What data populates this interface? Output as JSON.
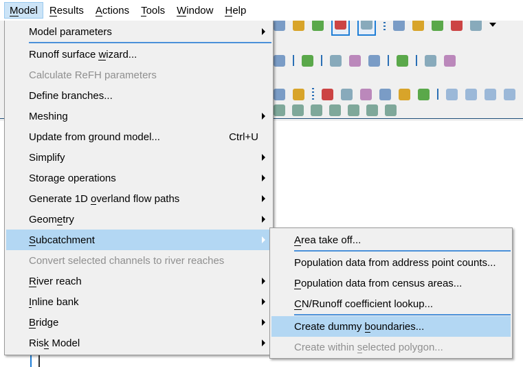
{
  "menubar": [
    {
      "label": "Model",
      "u": 0,
      "active": true
    },
    {
      "label": "Results",
      "u": 0
    },
    {
      "label": "Actions",
      "u": 0
    },
    {
      "label": "Tools",
      "u": 0
    },
    {
      "label": "Window",
      "u": 0
    },
    {
      "label": "Help",
      "u": 0
    }
  ],
  "model_menu": [
    {
      "label": "Model parameters",
      "submenu": true
    },
    {
      "separator": true
    },
    {
      "label": "Runoff surface wizard...",
      "u": 15
    },
    {
      "label": "Calculate ReFH parameters",
      "disabled": true
    },
    {
      "label": "Define branches..."
    },
    {
      "label": "Meshing",
      "submenu": true
    },
    {
      "label": "Update from ground model...",
      "shortcut": "Ctrl+U"
    },
    {
      "label": "Simplify",
      "submenu": true
    },
    {
      "label": "Storage operations",
      "submenu": true
    },
    {
      "label": "Generate 1D overland flow paths",
      "u": 12,
      "submenu": true
    },
    {
      "label": "Geometry",
      "u": 4,
      "submenu": true
    },
    {
      "label": "Subcatchment",
      "u": 0,
      "submenu": true,
      "highlighted": true
    },
    {
      "label": "Convert selected channels to river reaches",
      "disabled": true
    },
    {
      "label": "River reach",
      "u": 0,
      "submenu": true
    },
    {
      "label": "Inline bank",
      "u": 0,
      "submenu": true
    },
    {
      "label": "Bridge",
      "u": 0,
      "submenu": true
    },
    {
      "label": "Risk Model",
      "u": 3,
      "submenu": true
    }
  ],
  "subcatchment_menu": [
    {
      "label": "Area take off...",
      "u": 0
    },
    {
      "separator": true
    },
    {
      "label": "Population data from address point counts..."
    },
    {
      "label": "Population data from census areas...",
      "u": 0
    },
    {
      "label": "CN/Runoff coefficient lookup...",
      "u": 0
    },
    {
      "separator": true
    },
    {
      "label": "Create dummy boundaries...",
      "u": 13,
      "highlighted": true
    },
    {
      "label": "Create within selected polygon...",
      "u": 14,
      "disabled": true
    }
  ],
  "toolbar_icons": {
    "row1": [
      "network-results-icon",
      "gears-icon",
      "graph-icon",
      "properties-toggle-icon",
      "window-toggle-icon",
      "|dots",
      "new-network-icon",
      "new-bridge-icon",
      "new-storage-icon",
      "new-terrain-icon",
      "new-grid-icon",
      "dropdown-arrow-icon"
    ],
    "row2": [
      "select-icon",
      "|",
      "pin-icon",
      "|",
      "pan-hand-icon",
      "zoom-in-icon",
      "zoom-out-icon",
      "|",
      "info-icon",
      "|",
      "find-time-icon",
      "xy-time-icon"
    ],
    "row3": [
      "pan-icon",
      "globe-icon",
      "|dots",
      "grid-green-icon",
      "grid-link-icon",
      "grid-white-icon",
      "grid-red-icon",
      "grid-pink-icon",
      "grid-blue-icon",
      "|",
      "play-grid-1-icon",
      "play-grid-2-icon",
      "play-grid-3-icon",
      "play-grid-4-icon"
    ],
    "row4": [
      "gear-4-icon",
      "gear-5-icon",
      "gear-6-icon",
      "gear-7-icon",
      "gear-8-icon",
      "gear-9-icon",
      "gear-10-icon"
    ]
  },
  "colors": {
    "highlight": "#b3d7f3",
    "accent": "#1e7ed6",
    "disabled": "#8f8f8f"
  }
}
